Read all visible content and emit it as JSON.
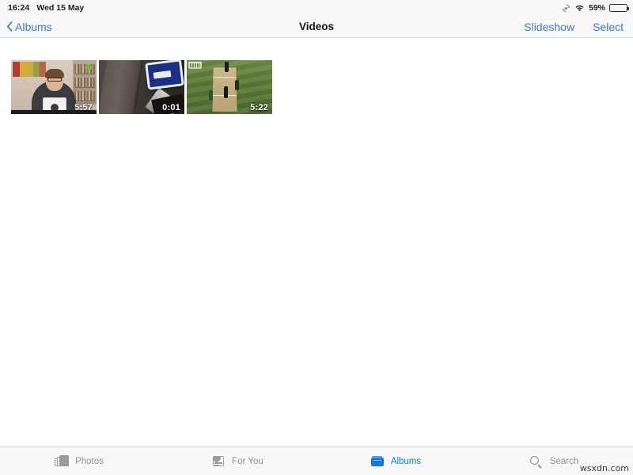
{
  "status_bar": {
    "time": "16:24",
    "date": "Wed 15 May",
    "rotation_lock_icon": "rotation-lock-icon",
    "wifi_icon": "wifi-icon",
    "battery_percent": "59%",
    "battery_level": 59,
    "battery_icon": "battery-icon"
  },
  "nav_bar": {
    "back_label": "Albums",
    "back_chevron_icon": "chevron-left-icon",
    "title": "Videos",
    "slideshow_label": "Slideshow",
    "select_label": "Select"
  },
  "grid": {
    "items": [
      {
        "duration": "5:57",
        "scene": "person-at-desk-with-tablet"
      },
      {
        "duration": "0:01",
        "scene": "road-with-blue-sign"
      },
      {
        "duration": "5:22",
        "scene": "cricket-field"
      }
    ]
  },
  "tab_bar": {
    "items": [
      {
        "label": "Photos",
        "icon": "photos-icon",
        "active": false
      },
      {
        "label": "For You",
        "icon": "for-you-icon",
        "active": false
      },
      {
        "label": "Albums",
        "icon": "albums-icon",
        "active": true
      },
      {
        "label": "Search",
        "icon": "search-icon",
        "active": false
      }
    ]
  },
  "watermark": "wsxdn.com",
  "colors": {
    "accent_blue": "#3b7ebf",
    "tab_active_blue": "#1277e2",
    "tab_inactive_gray": "#8e8e93",
    "bar_background": "#f8f8f8",
    "content_background": "#ffffff"
  }
}
